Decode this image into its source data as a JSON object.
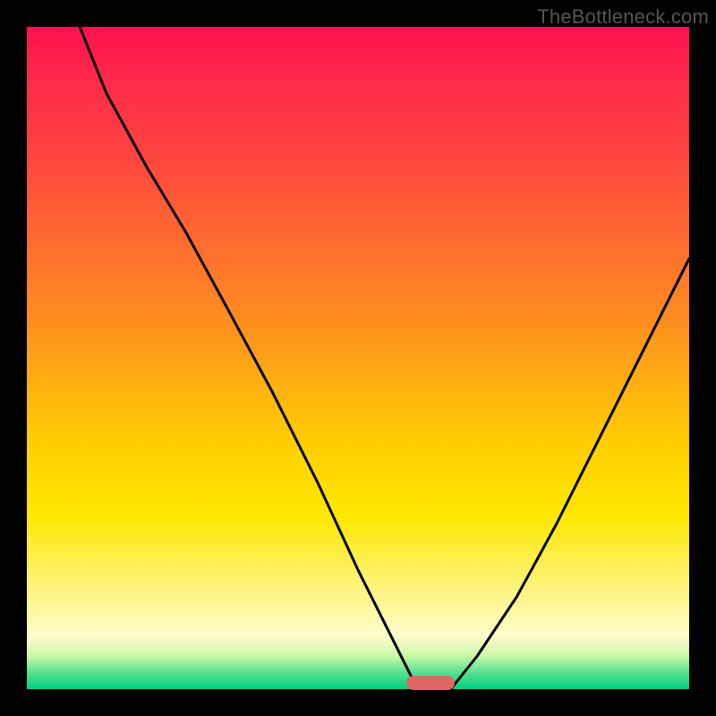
{
  "watermark": "TheBottleneck.com",
  "colors": {
    "frame": "#000000",
    "curve": "#000000",
    "marker": "#e06666",
    "gradient_top": "#ff1050",
    "gradient_bottom": "#00d080"
  },
  "chart_data": {
    "type": "line",
    "title": "",
    "xlabel": "",
    "ylabel": "",
    "xlim": [
      0,
      100
    ],
    "ylim": [
      0,
      100
    ],
    "grid": false,
    "legend": false,
    "annotations": [
      {
        "name": "marker",
        "x": 61,
        "y": 1
      }
    ],
    "series": [
      {
        "name": "left-branch",
        "x": [
          8,
          12,
          18,
          24,
          30,
          37,
          44,
          50,
          55,
          58,
          60
        ],
        "y": [
          100,
          90,
          79,
          69,
          58,
          45,
          31,
          18,
          8,
          2,
          0
        ]
      },
      {
        "name": "floor",
        "x": [
          60,
          64
        ],
        "y": [
          0,
          0
        ]
      },
      {
        "name": "right-branch",
        "x": [
          64,
          68,
          74,
          80,
          86,
          92,
          97,
          100
        ],
        "y": [
          0,
          5,
          14,
          25,
          37,
          49,
          59,
          65
        ]
      }
    ]
  }
}
